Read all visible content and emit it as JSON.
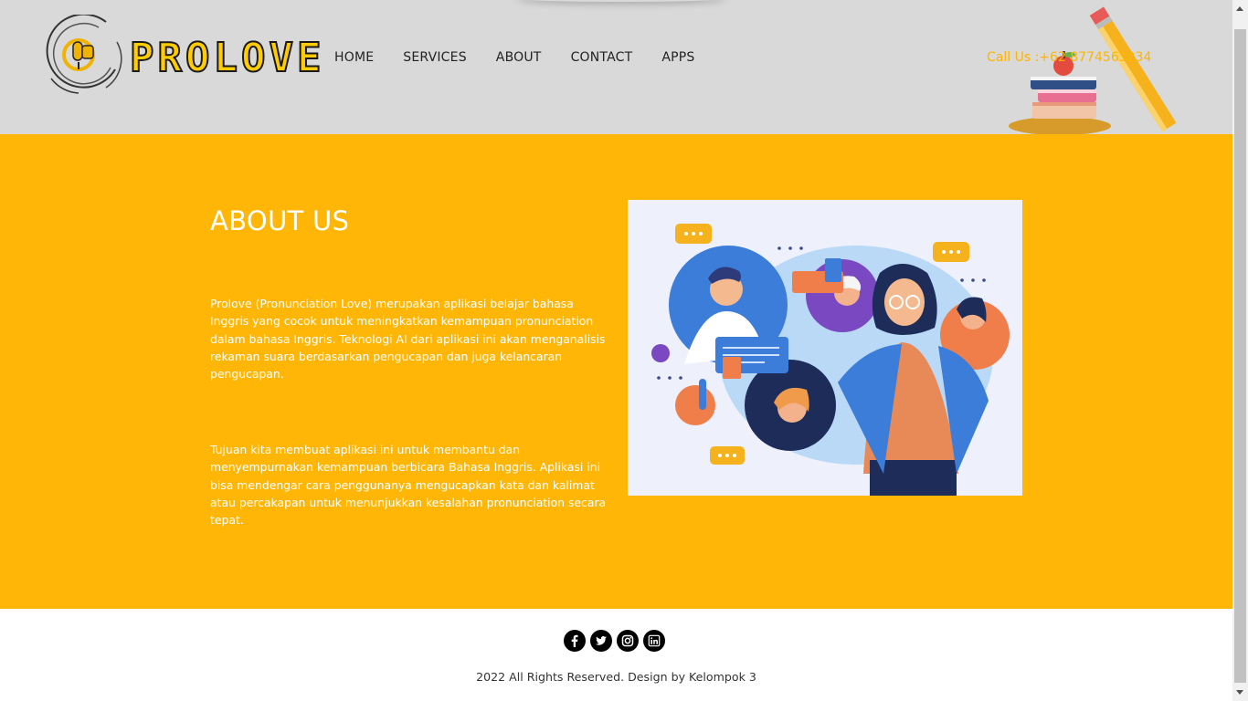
{
  "brand": {
    "name": "PROLOVE",
    "logo_text": "P"
  },
  "nav": {
    "items": [
      {
        "label": "HOME"
      },
      {
        "label": "SERVICES"
      },
      {
        "label": "ABOUT"
      },
      {
        "label": "CONTACT"
      },
      {
        "label": "APPS"
      }
    ]
  },
  "header": {
    "call": "Call Us :+62 8774563234"
  },
  "about": {
    "title": "ABOUT US",
    "paragraph1": "Prolove (Pronunciation Love) merupakan aplikasi belajar bahasa Inggris yang cocok untuk meningkatkan kemampuan pronunciation dalam bahasa Inggris. Teknologi AI dari aplikasi ini akan menganalisis rekaman suara berdasarkan pengucapan dan juga kelancaran pengucapan.",
    "paragraph2": "Tujuan kita membuat aplikasi ini untuk membantu dan menyempurnakan kemampuan berbicara Bahasa Inggris. Aplikasi ini bisa mendengar cara penggunanya mengucapkan kata dan kalimat atau percakapan untuk menunjukkan kesalahan pronunciation secara tepat."
  },
  "footer": {
    "socials": [
      "facebook-icon",
      "twitter-icon",
      "instagram-icon",
      "linkedin-icon"
    ],
    "copyright": "2022 All Rights Reserved. Design by Kelompok 3"
  },
  "colors": {
    "header_bg": "#d9d9d9",
    "accent": "#ffb606",
    "call_text": "#ffb400",
    "brand_fill": "#ffcc00"
  }
}
